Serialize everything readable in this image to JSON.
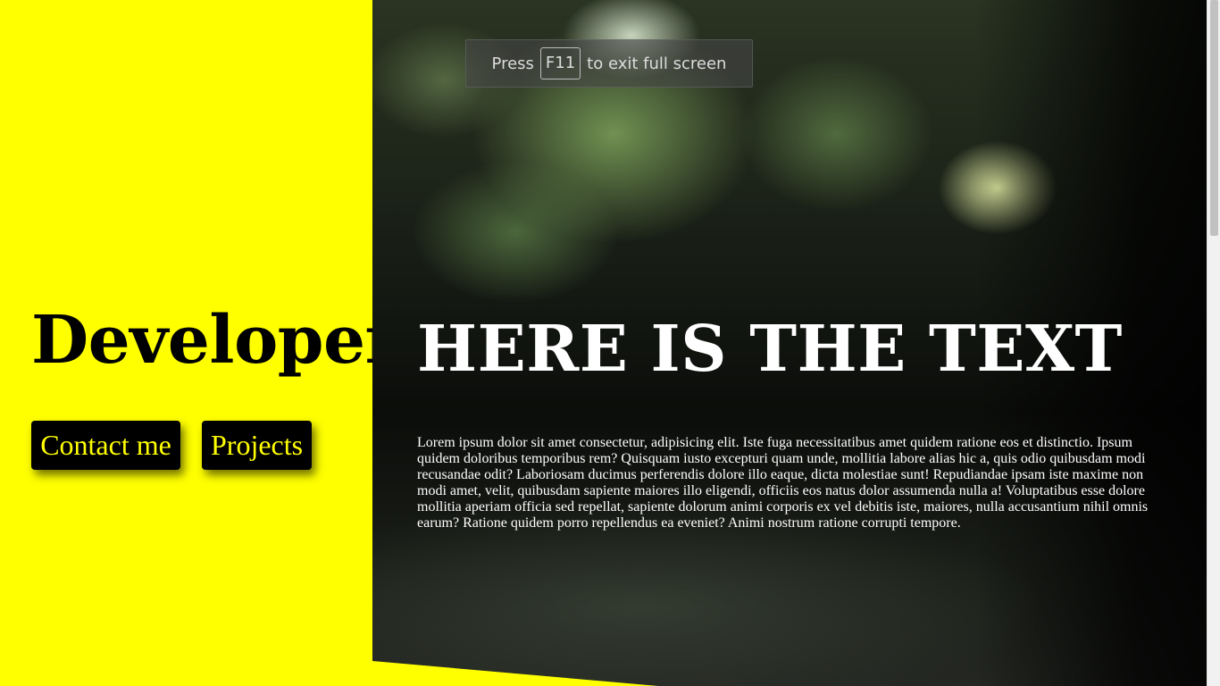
{
  "left": {
    "title": "Developer",
    "contact_label": "Contact me",
    "projects_label": "Projects"
  },
  "hero": {
    "heading": "HERE IS THE TEXT",
    "body": "Lorem ipsum dolor sit amet consectetur, adipisicing elit. Iste fuga necessitatibus amet quidem ratione eos et distinctio. Ipsum quidem doloribus temporibus rem? Quisquam iusto excepturi quam unde, mollitia labore alias hic a, quis odio quibusdam modi recusandae odit? Laboriosam ducimus perferendis dolore illo eaque, dicta molestiae sunt! Repudiandae ipsam iste maxime non modi amet, velit, quibusdam sapiente maiores illo eligendi, officiis eos natus dolor assumenda nulla a! Voluptatibus esse dolore mollitia aperiam officia sed repellat, sapiente dolorum animi corporis ex vel debitis iste, maiores, nulla accusantium nihil omnis earum? Ratione quidem porro repellendus ea eveniet? Animi nostrum ratione corrupti tempore."
  },
  "fullscreen_notice": {
    "prefix": "Press",
    "key": "F11",
    "suffix": "to exit full screen"
  },
  "colors": {
    "accent_yellow": "#ffff00",
    "button_bg": "#000000",
    "hero_text": "#ffffff"
  }
}
